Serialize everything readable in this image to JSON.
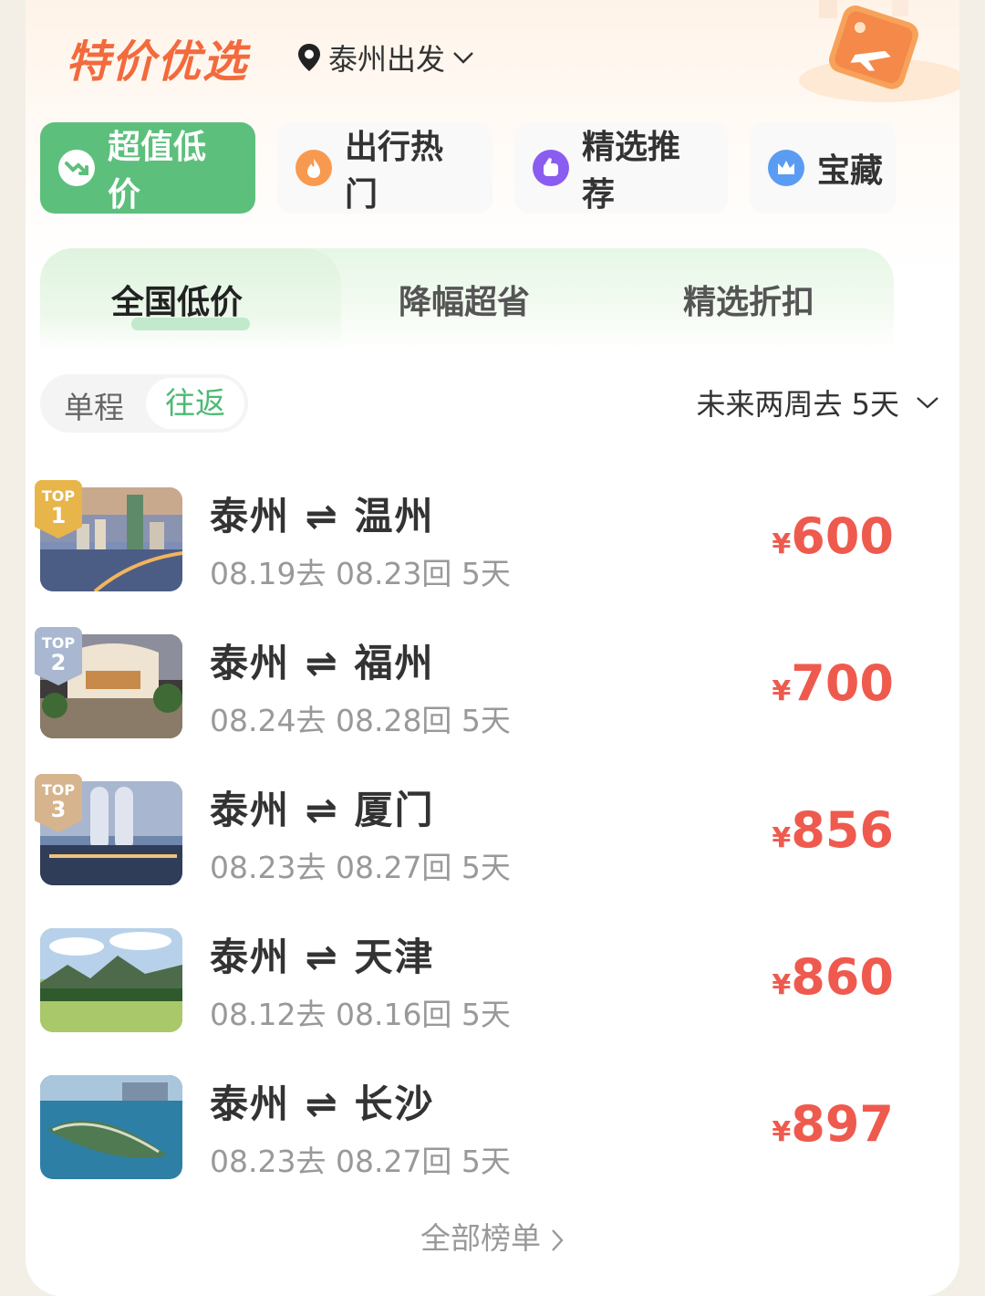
{
  "header": {
    "title": "特价优选",
    "location": "泰州出发"
  },
  "categories": [
    {
      "label": "超值低价",
      "icon": "trend-down-icon",
      "active": true
    },
    {
      "label": "出行热门",
      "icon": "flame-icon",
      "active": false
    },
    {
      "label": "精选推荐",
      "icon": "thumb-icon",
      "active": false
    },
    {
      "label": "宝藏",
      "icon": "crown-icon",
      "active": false
    }
  ],
  "subtabs": [
    "全国低价",
    "降幅超省",
    "精选折扣"
  ],
  "trip_type": {
    "one_way": "单程",
    "round_trip": "往返"
  },
  "period": "未来两周去 5天",
  "routes": [
    {
      "from": "泰州",
      "to": "温州",
      "dates": "08.19去 08.23回 5天",
      "currency": "¥",
      "price": "600",
      "rank": "1"
    },
    {
      "from": "泰州",
      "to": "福州",
      "dates": "08.24去 08.28回 5天",
      "currency": "¥",
      "price": "700",
      "rank": "2"
    },
    {
      "from": "泰州",
      "to": "厦门",
      "dates": "08.23去 08.27回 5天",
      "currency": "¥",
      "price": "856",
      "rank": "3"
    },
    {
      "from": "泰州",
      "to": "天津",
      "dates": "08.12去 08.16回 5天",
      "currency": "¥",
      "price": "860",
      "rank": ""
    },
    {
      "from": "泰州",
      "to": "长沙",
      "dates": "08.23去 08.27回 5天",
      "currency": "¥",
      "price": "897",
      "rank": ""
    }
  ],
  "route_arrow": "⇌",
  "badge_top": "TOP",
  "footer_link": "全部榜单",
  "colors": {
    "accent_green": "#5dbf7c",
    "price_red": "#ef5a4e",
    "brand_orange": "#f26a3d"
  }
}
